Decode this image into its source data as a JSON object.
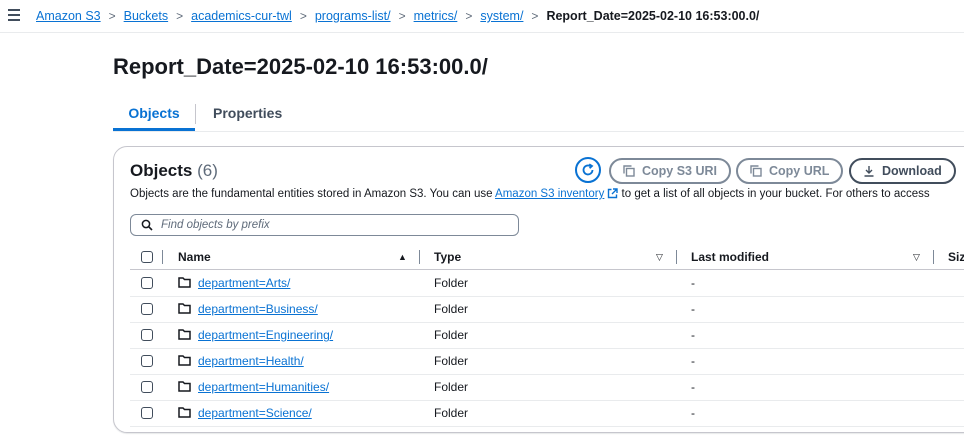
{
  "breadcrumb": {
    "items": [
      "Amazon S3",
      "Buckets",
      "academics-cur-twl",
      "programs-list/",
      "metrics/",
      "system/"
    ],
    "current": "Report_Date=2025-02-10 16:53:00.0/"
  },
  "page": {
    "title": "Report_Date=2025-02-10 16:53:00.0/"
  },
  "tabs": [
    {
      "label": "Objects",
      "active": true
    },
    {
      "label": "Properties",
      "active": false
    }
  ],
  "objects_panel": {
    "title": "Objects",
    "count": "(6)",
    "buttons": {
      "copy_uri": "Copy S3 URI",
      "copy_url": "Copy URL",
      "download": "Download"
    },
    "description": {
      "before": "Objects are the fundamental entities stored in Amazon S3. You can use ",
      "link": "Amazon S3 inventory",
      "after": " to get a list of all objects in your bucket. For others to access"
    },
    "search_placeholder": "Find objects by prefix"
  },
  "table": {
    "columns": [
      "Name",
      "Type",
      "Last modified",
      "Siz"
    ],
    "rows": [
      {
        "name": "department=Arts/",
        "type": "Folder",
        "last_modified": "-"
      },
      {
        "name": "department=Business/",
        "type": "Folder",
        "last_modified": "-"
      },
      {
        "name": "department=Engineering/",
        "type": "Folder",
        "last_modified": "-"
      },
      {
        "name": "department=Health/",
        "type": "Folder",
        "last_modified": "-"
      },
      {
        "name": "department=Humanities/",
        "type": "Folder",
        "last_modified": "-"
      },
      {
        "name": "department=Science/",
        "type": "Folder",
        "last_modified": "-"
      }
    ]
  },
  "colors": {
    "accent": "#0972d3",
    "text": "#16191f",
    "disabled": "#7d8998"
  },
  "icons": [
    "menu-icon",
    "chevron-right-icon",
    "refresh-icon",
    "copy-icon",
    "download-icon",
    "external-link-icon",
    "search-icon",
    "sort-asc-icon",
    "sort-desc-icon",
    "folder-icon"
  ]
}
